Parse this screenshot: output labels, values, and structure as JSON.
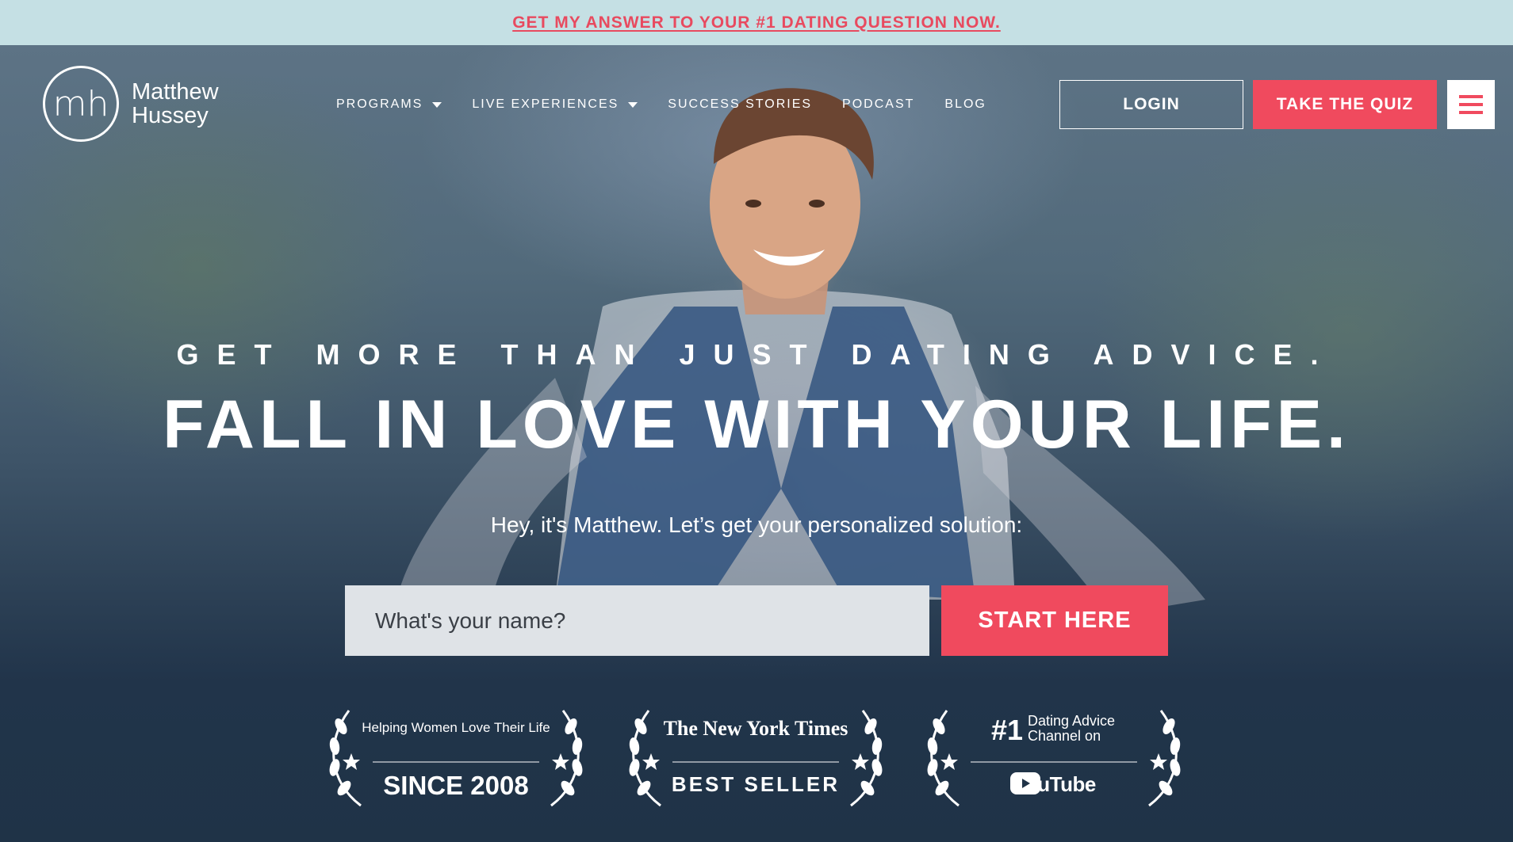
{
  "announcement": {
    "link_text": "GET MY ANSWER TO YOUR #1 DATING QUESTION NOW."
  },
  "logo": {
    "monogram": "mh",
    "line1": "Matthew",
    "line2": "Hussey"
  },
  "nav": {
    "items": [
      {
        "label": "PROGRAMS",
        "dropdown": true
      },
      {
        "label": "LIVE EXPERIENCES",
        "dropdown": true
      },
      {
        "label": "SUCCESS STORIES",
        "dropdown": false
      },
      {
        "label": "PODCAST",
        "dropdown": false
      },
      {
        "label": "BLOG",
        "dropdown": false
      }
    ],
    "login_label": "LOGIN",
    "quiz_label": "TAKE THE QUIZ",
    "menu_icon": "hamburger-menu-icon"
  },
  "hero": {
    "eyebrow": "GET MORE THAN JUST DATING ADVICE.",
    "headline": "FALL IN LOVE WITH YOUR LIFE.",
    "subline": "Hey, it's Matthew. Let’s get your personalized solution:",
    "name_placeholder": "What's your name?",
    "start_label": "START HERE"
  },
  "badges": [
    {
      "top": "Helping Women Love Their Life",
      "bottom": "SINCE 2008",
      "icon": "laurel-icon"
    },
    {
      "top": "The New York Times",
      "bottom": "BEST SELLER",
      "icon": "laurel-icon"
    },
    {
      "top_rank": "#1",
      "top": "Dating Advice",
      "top2": "Channel on",
      "bottom": "YouTube",
      "icon": "youtube-icon"
    }
  ],
  "colors": {
    "accent": "#f04a5e",
    "announcement_bg": "#c5e0e4",
    "hero_dark": "#1f3347"
  }
}
